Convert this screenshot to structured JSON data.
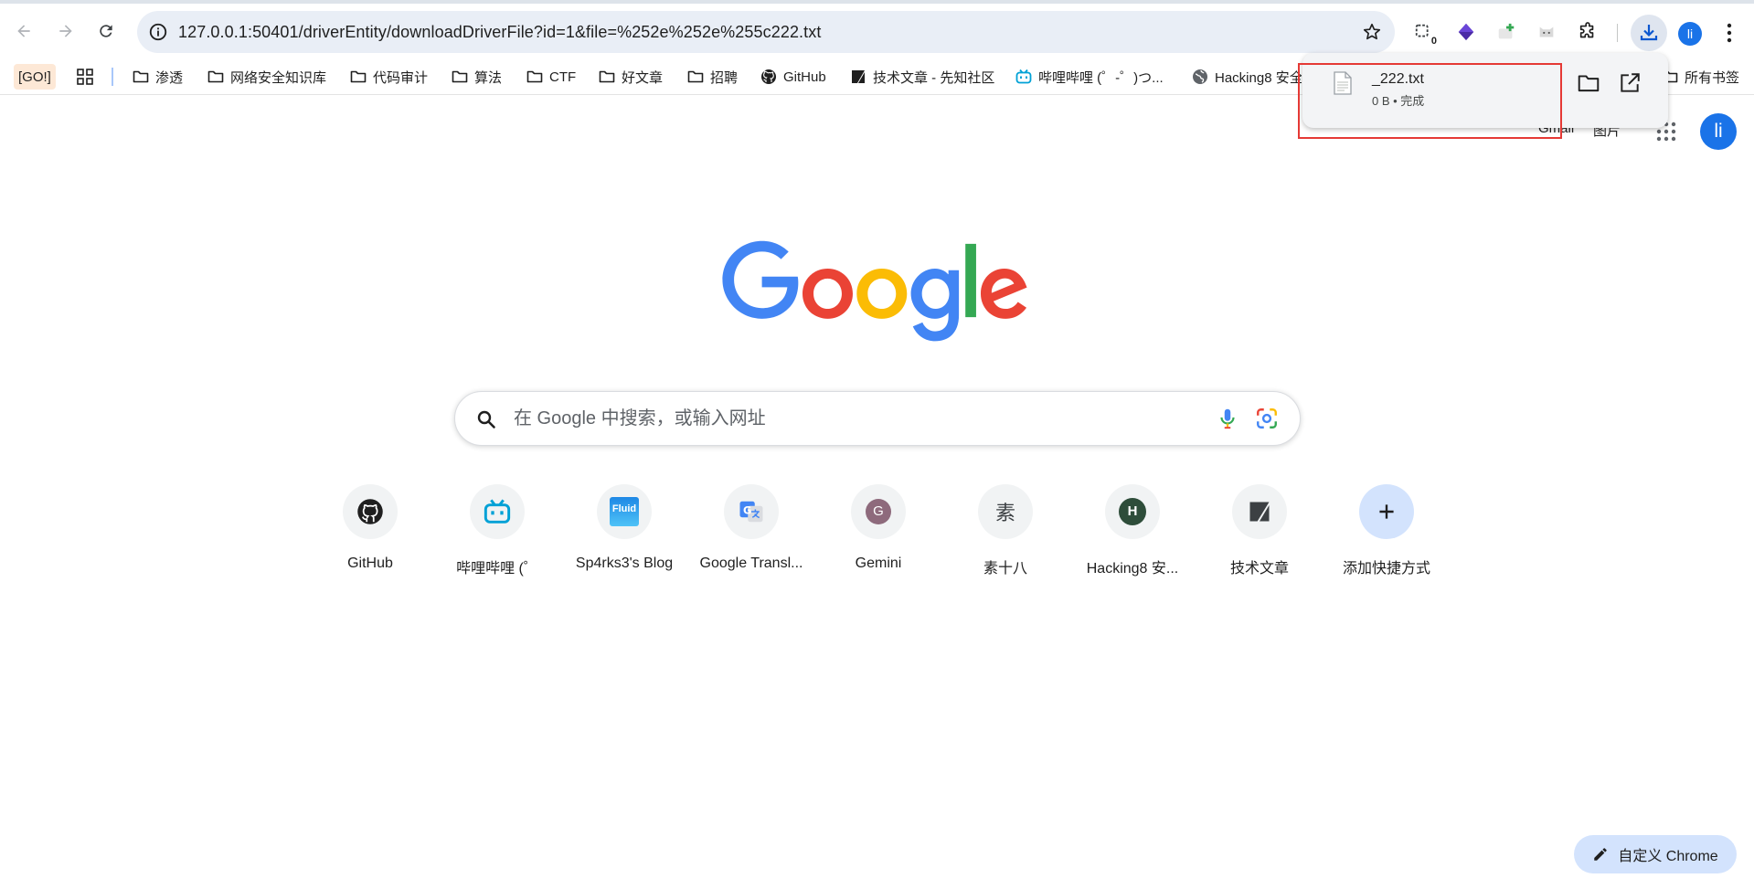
{
  "toolbar": {
    "url": "127.0.0.1:50401/driverEntity/downloadDriverFile?id=1&file=%252e%252e%255c222.txt",
    "ext_badge": "0",
    "profile_initial": "li"
  },
  "bookmarks": [
    {
      "label": "[GO!]"
    },
    {
      "label": "渗透"
    },
    {
      "label": "网络安全知识库"
    },
    {
      "label": "代码审计"
    },
    {
      "label": "算法"
    },
    {
      "label": "CTF"
    },
    {
      "label": "好文章"
    },
    {
      "label": "招聘"
    },
    {
      "label": "GitHub"
    },
    {
      "label": "技术文章 - 先知社区"
    },
    {
      "label": "哔哩哔哩 (゜-゜)つ..."
    },
    {
      "label": "Hacking8 安全"
    },
    {
      "label": "所有书签"
    }
  ],
  "download": {
    "filename": "_222.txt",
    "status": "0 B • 完成"
  },
  "google": {
    "gmail": "Gmail",
    "images": "图片",
    "profile_initial": "li"
  },
  "search": {
    "placeholder": "在 Google 中搜索，或输入网址"
  },
  "shortcuts": [
    {
      "label": "GitHub"
    },
    {
      "label": "哔哩哔哩 (゜"
    },
    {
      "label": "Sp4rks3's Blog"
    },
    {
      "label": "Google Transl..."
    },
    {
      "label": "Gemini",
      "letter": "G"
    },
    {
      "label": "素十八",
      "letter": "素"
    },
    {
      "label": "Hacking8 安...",
      "letter": "H"
    },
    {
      "label": "技术文章"
    },
    {
      "label": "添加快捷方式"
    }
  ],
  "fluid_text": "Fluid",
  "customize": {
    "label": "自定义 Chrome"
  },
  "colors": {
    "blue": "#4285F4",
    "red": "#EA4335",
    "yellow": "#FBBC05",
    "green": "#34A853",
    "highlight": "#e53935"
  }
}
